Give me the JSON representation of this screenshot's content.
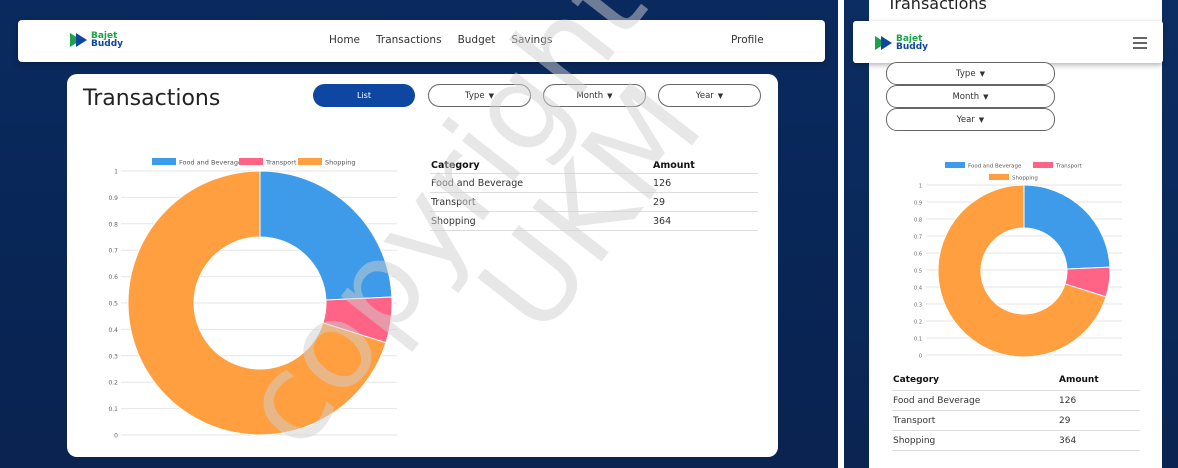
{
  "brand": {
    "line1": "Bajet",
    "line2": "Buddy"
  },
  "nav": {
    "links": [
      "Home",
      "Transactions",
      "Budget",
      "Savings"
    ],
    "profile": "Profile"
  },
  "page": {
    "title": "Transactions"
  },
  "controls": {
    "list_label": "List",
    "type_label": "Type",
    "month_label": "Month",
    "year_label": "Year"
  },
  "table": {
    "headers": [
      "Category",
      "Amount"
    ],
    "rows": [
      [
        "Food and Beverage",
        "126"
      ],
      [
        "Transport",
        "29"
      ],
      [
        "Shopping",
        "364"
      ]
    ]
  },
  "chart_data": [
    {
      "type": "pie",
      "variant": "doughnut",
      "categories": [
        "Food and Beverage",
        "Transport",
        "Shopping"
      ],
      "values": [
        126,
        29,
        364
      ],
      "colors": [
        "#3d9be9",
        "#ff6385",
        "#ff9f40"
      ],
      "legend": "top",
      "y_ticks": [
        "1",
        "0.9",
        "0.8",
        "0.7",
        "0.6",
        "0.5",
        "0.4",
        "0.3",
        "0.2",
        "0.1",
        "0"
      ],
      "grid": true
    },
    {
      "type": "pie",
      "variant": "doughnut",
      "categories": [
        "Food and Beverage",
        "Transport",
        "Shopping"
      ],
      "values": [
        126,
        29,
        364
      ],
      "colors": [
        "#3d9be9",
        "#ff6385",
        "#ff9f40"
      ],
      "legend": "top",
      "y_ticks": [
        "1",
        "0.9",
        "0.8",
        "0.7",
        "0.6",
        "0.5",
        "0.4",
        "0.3",
        "0.2",
        "0.1",
        "0"
      ],
      "grid": true
    }
  ],
  "mobile": {
    "title": "Transactions"
  },
  "watermark": {
    "line1": "copyright@",
    "line2": "UKM"
  },
  "colors": {
    "primary": "#0d47a1",
    "brand_green": "#1aa34a"
  }
}
